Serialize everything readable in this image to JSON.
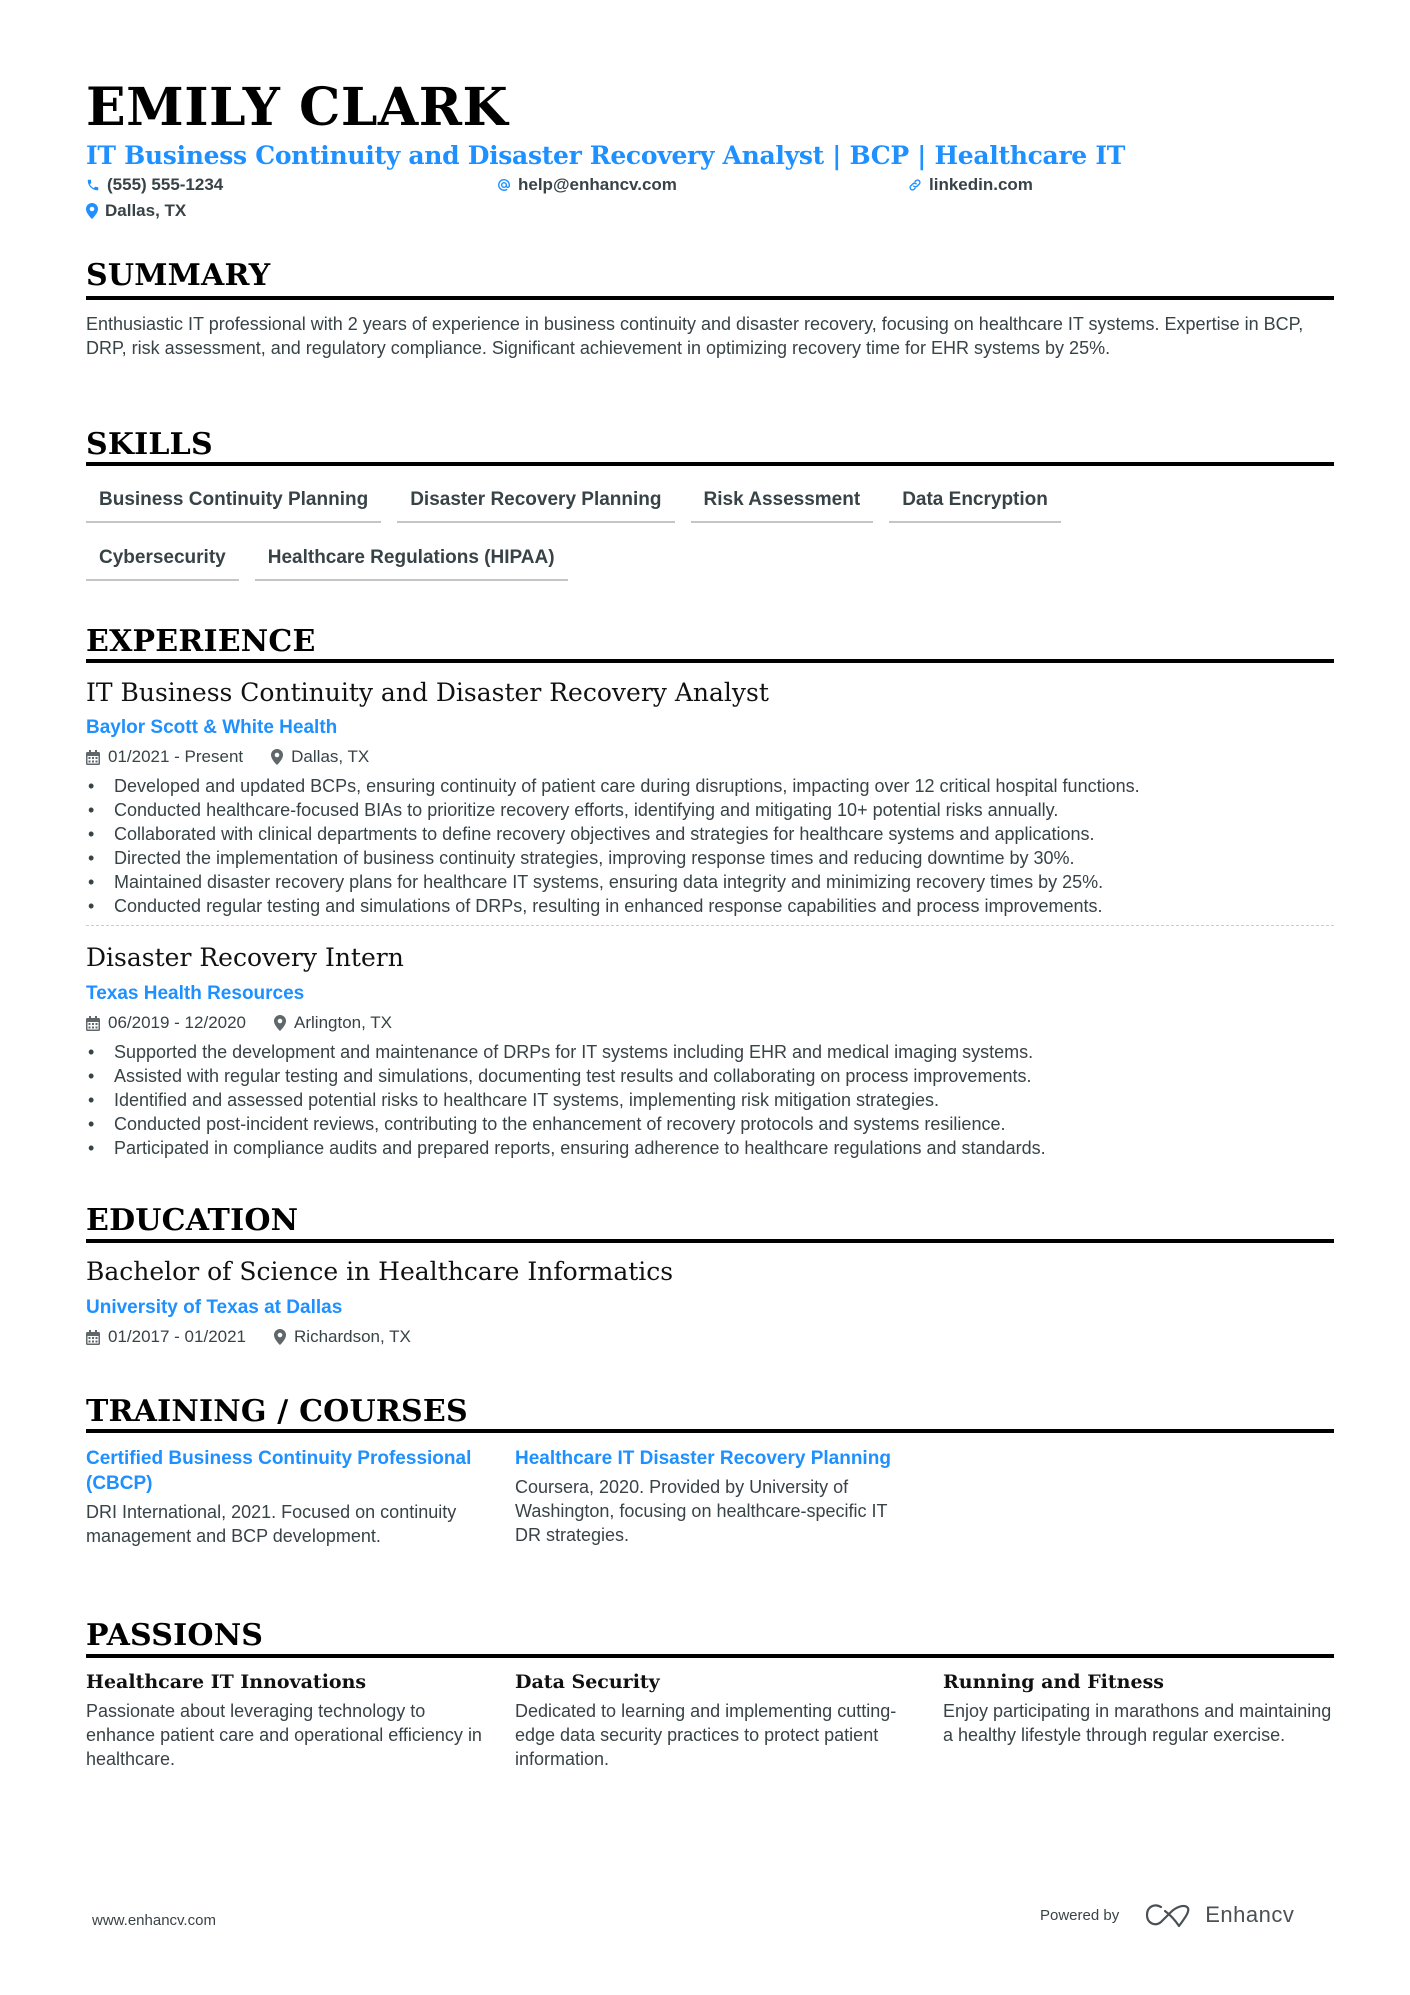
{
  "header": {
    "name": "EMILY CLARK",
    "title": "IT Business Continuity and Disaster Recovery Analyst | BCP | Healthcare IT",
    "contacts": {
      "phone": "(555) 555-1234",
      "email": "help@enhancv.com",
      "linkedin": "linkedin.com",
      "location": "Dallas, TX"
    },
    "icons": {
      "phone": "phone-icon",
      "email": "at-icon",
      "linkedin": "link-icon",
      "location": "location-pin-icon"
    }
  },
  "colors": {
    "accent": "#1e90ff",
    "text": "#384347",
    "heading": "#000000"
  },
  "summary": {
    "heading": "SUMMARY",
    "text": "Enthusiastic IT professional with 2 years of experience in business continuity and disaster recovery, focusing on healthcare IT systems. Expertise in BCP, DRP, risk assessment, and regulatory compliance. Significant achievement in optimizing recovery time for EHR systems by 25%."
  },
  "skills": {
    "heading": "SKILLS",
    "items": [
      "Business Continuity Planning",
      "Disaster Recovery Planning",
      "Risk Assessment",
      "Data Encryption",
      "Cybersecurity",
      "Healthcare Regulations (HIPAA)"
    ]
  },
  "experience": {
    "heading": "EXPERIENCE",
    "jobs": [
      {
        "title": "IT Business Continuity and Disaster Recovery Analyst",
        "company": "Baylor Scott & White Health",
        "dates": "01/2021 - Present",
        "location": "Dallas, TX",
        "bullets": [
          "Developed and updated BCPs, ensuring continuity of patient care during disruptions, impacting over 12 critical hospital functions.",
          "Conducted healthcare-focused BIAs to prioritize recovery efforts, identifying and mitigating 10+ potential risks annually.",
          "Collaborated with clinical departments to define recovery objectives and strategies for healthcare systems and applications.",
          "Directed the implementation of business continuity strategies, improving response times and reducing downtime by 30%.",
          "Maintained disaster recovery plans for healthcare IT systems, ensuring data integrity and minimizing recovery times by 25%.",
          "Conducted regular testing and simulations of DRPs, resulting in enhanced response capabilities and process improvements."
        ]
      },
      {
        "title": "Disaster Recovery Intern",
        "company": "Texas Health Resources",
        "dates": "06/2019 - 12/2020",
        "location": "Arlington, TX",
        "bullets": [
          "Supported the development and maintenance of DRPs for IT systems including EHR and medical imaging systems.",
          "Assisted with regular testing and simulations, documenting test results and collaborating on process improvements.",
          "Identified and assessed potential risks to healthcare IT systems, implementing risk mitigation strategies.",
          "Conducted post-incident reviews, contributing to the enhancement of recovery protocols and systems resilience.",
          "Participated in compliance audits and prepared reports, ensuring adherence to healthcare regulations and standards."
        ]
      }
    ]
  },
  "education": {
    "heading": "EDUCATION",
    "degree": "Bachelor of Science in Healthcare Informatics",
    "school": "University of Texas at Dallas",
    "dates": "01/2017 - 01/2021",
    "location": "Richardson, TX"
  },
  "training": {
    "heading": "TRAINING / COURSES",
    "items": [
      {
        "title": "Certified Business Continuity Professional (CBCP)",
        "description": "DRI International, 2021. Focused on continuity management and BCP development."
      },
      {
        "title": "Healthcare IT Disaster Recovery Planning",
        "description": "Coursera, 2020. Provided by University of Washington, focusing on healthcare-specific IT DR strategies."
      }
    ]
  },
  "passions": {
    "heading": "PASSIONS",
    "items": [
      {
        "title": "Healthcare IT Innovations",
        "description": "Passionate about leveraging technology to enhance patient care and operational efficiency in healthcare."
      },
      {
        "title": "Data Security",
        "description": "Dedicated to learning and implementing cutting-edge data security practices to protect patient information."
      },
      {
        "title": "Running and Fitness",
        "description": "Enjoy participating in marathons and maintaining a healthy lifestyle through regular exercise."
      }
    ]
  },
  "footer": {
    "website": "www.enhancv.com",
    "powered_by": "Powered by",
    "brand": "Enhancv"
  }
}
